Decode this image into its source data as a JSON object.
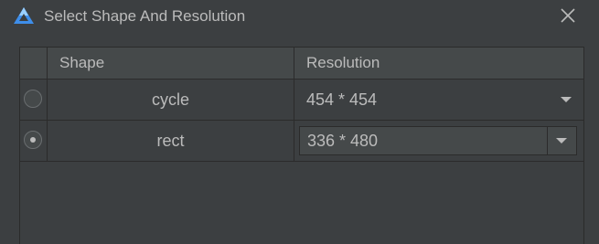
{
  "window": {
    "title": "Select Shape And Resolution",
    "logo_icon": "harmony-deveco-logo-icon",
    "close_icon": "close-icon"
  },
  "colors": {
    "background": "#3c3f41",
    "header": "#45494a",
    "text": "#bbbbbb",
    "border": "#2b2b2b",
    "logo_light": "#9ad0ff",
    "logo_dark": "#3e8eea"
  },
  "table": {
    "columns": [
      "",
      "Shape",
      "Resolution"
    ],
    "rows": [
      {
        "selected": false,
        "shape": "cycle",
        "resolution": "454 * 454"
      },
      {
        "selected": true,
        "shape": "rect",
        "resolution": "336 * 480"
      }
    ]
  }
}
